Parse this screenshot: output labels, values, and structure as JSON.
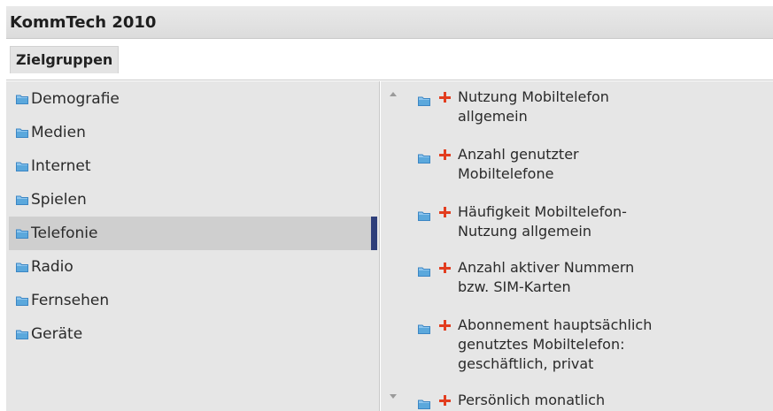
{
  "app": {
    "title": "KommTech 2010"
  },
  "tabs": [
    {
      "label": "Zielgruppen",
      "active": true
    }
  ],
  "categories": [
    {
      "label": "Demografie",
      "icon": "folder-icon",
      "selected": false
    },
    {
      "label": "Medien",
      "icon": "folder-icon",
      "selected": false
    },
    {
      "label": "Internet",
      "icon": "folder-icon",
      "selected": false
    },
    {
      "label": "Spielen",
      "icon": "folder-icon",
      "selected": false
    },
    {
      "label": "Telefonie",
      "icon": "folder-icon",
      "selected": true
    },
    {
      "label": "Radio",
      "icon": "folder-icon",
      "selected": false
    },
    {
      "label": "Fernsehen",
      "icon": "folder-icon",
      "selected": false
    },
    {
      "label": "Geräte",
      "icon": "folder-icon",
      "selected": false
    }
  ],
  "subitems": [
    {
      "line1": "Nutzung Mobiltelefon",
      "line2": "allgemein",
      "line3": ""
    },
    {
      "line1": "Anzahl genutzter",
      "line2": "Mobiltelefone",
      "line3": ""
    },
    {
      "line1": "Häufigkeit Mobiltelefon-",
      "line2": "Nutzung allgemein",
      "line3": ""
    },
    {
      "line1": "Anzahl aktiver Nummern",
      "line2": "bzw. SIM-Karten",
      "line3": ""
    },
    {
      "line1": "Abonnement hauptsächlich",
      "line2": "genutztes Mobiltelefon:",
      "line3": "geschäftlich, privat"
    },
    {
      "line1": "Persönlich monatlich",
      "line2": "",
      "line3": ""
    }
  ],
  "colors": {
    "selection_marker": "#2f3f7a",
    "plus_icon": "#e23d1f",
    "folder_icon": "#5ba8dc",
    "pane_background": "#e6e6e6",
    "selected_background": "#cfcfcf"
  }
}
